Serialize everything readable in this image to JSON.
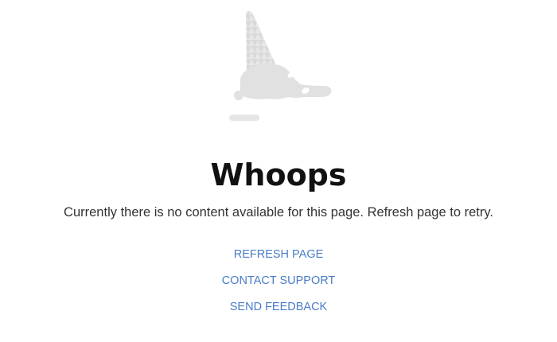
{
  "illustration": {
    "icon": "dropped-ice-cream-cone-icon",
    "color": "#e1e1e1"
  },
  "heading": "Whoops",
  "message": "Currently there is no content available for this page. Refresh page to retry.",
  "actions": {
    "refresh": "REFRESH PAGE",
    "contact": "CONTACT SUPPORT",
    "feedback": "SEND FEEDBACK"
  },
  "colors": {
    "link": "#4a7cc9",
    "heading": "#111111",
    "text": "#333333",
    "background": "#ffffff"
  }
}
